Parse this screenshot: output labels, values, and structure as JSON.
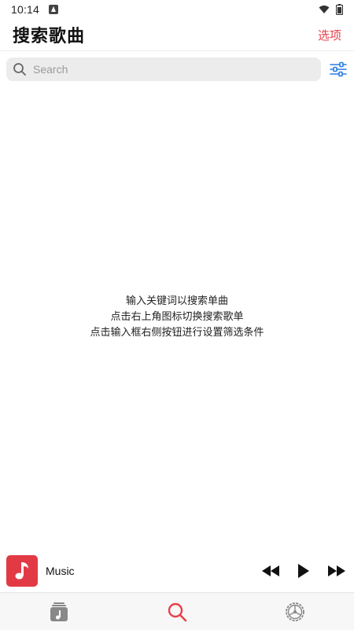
{
  "status_bar": {
    "time": "10:14"
  },
  "header": {
    "title": "搜索歌曲",
    "options_label": "选项"
  },
  "search": {
    "placeholder": "Search",
    "value": ""
  },
  "empty_state": {
    "lines": [
      "输入关键词以搜索单曲",
      "点击右上角图标切换搜索歌单",
      "点击输入框右侧按钮进行设置筛选条件"
    ]
  },
  "player": {
    "track_title": "Music"
  },
  "tabs": [
    {
      "icon": "music-library-icon",
      "active": false
    },
    {
      "icon": "search-icon",
      "active": true
    },
    {
      "icon": "settings-icon",
      "active": false
    }
  ],
  "colors": {
    "accent": "#e8404a",
    "filter_icon": "#2a7de1",
    "search_bg": "#ececec",
    "inactive_icon": "#888888"
  }
}
